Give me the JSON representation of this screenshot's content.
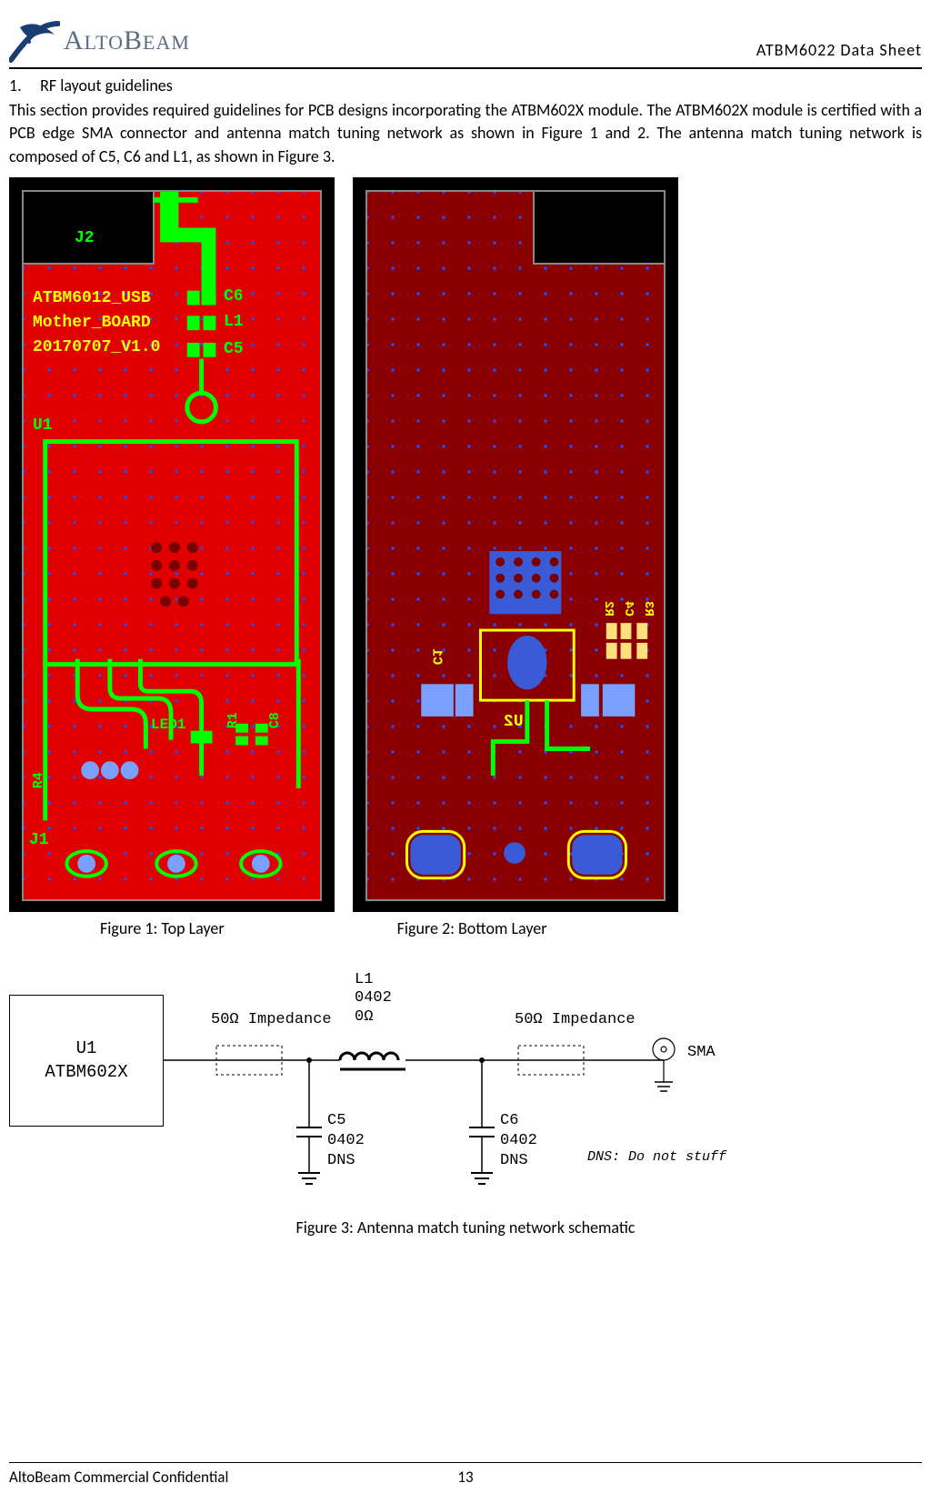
{
  "header": {
    "company": "ALTOBEAM",
    "doc_title": "ATBM6022  Data  Sheet"
  },
  "section": {
    "num": "1.",
    "title": "RF layout guidelines",
    "para": "This section provides required guidelines for PCB designs incorporating the ATBM602X module. The ATBM602X module is certified with a PCB edge SMA connector and antenna match tuning network as shown in Figure 1 and 2. The antenna match tuning network is composed of C5, C6 and L1, as shown in Figure 3."
  },
  "pcb_top_silk": {
    "j2": "J2",
    "board_line1": "ATBM6012_USB",
    "board_line2": "Mother_BOARD",
    "board_line3": "20170707_V1.0",
    "c6": "C6",
    "l1": "L1",
    "c5": "C5",
    "u1": "U1",
    "led1": "LED1",
    "j1": "J1",
    "r4": "R4",
    "r1": "R1",
    "c8": "C8"
  },
  "pcb_bottom_silk": {
    "u2": "U2",
    "c1": "C1",
    "r2": "R2",
    "c4": "C4",
    "r3": "R3"
  },
  "captions": {
    "fig1": "Figure 1: Top Layer",
    "fig2": "Figure 2: Bottom Layer",
    "fig3": "Figure 3: Antenna match tuning network schematic"
  },
  "schematic": {
    "u1_line1": "U1",
    "u1_line2": "ATBM602X",
    "imp_left": "50Ω Impedance",
    "imp_right": "50Ω Impedance",
    "l1_line1": "L1",
    "l1_line2": "0402",
    "l1_line3": "0Ω",
    "c5_line1": "C5",
    "c5_line2": "0402",
    "c5_line3": "DNS",
    "c6_line1": "C6",
    "c6_line2": "0402",
    "c6_line3": "DNS",
    "sma": "SMA",
    "note": "DNS: Do not stuff"
  },
  "footer": {
    "left": "AltoBeam Commercial Confidential",
    "page": "13"
  }
}
